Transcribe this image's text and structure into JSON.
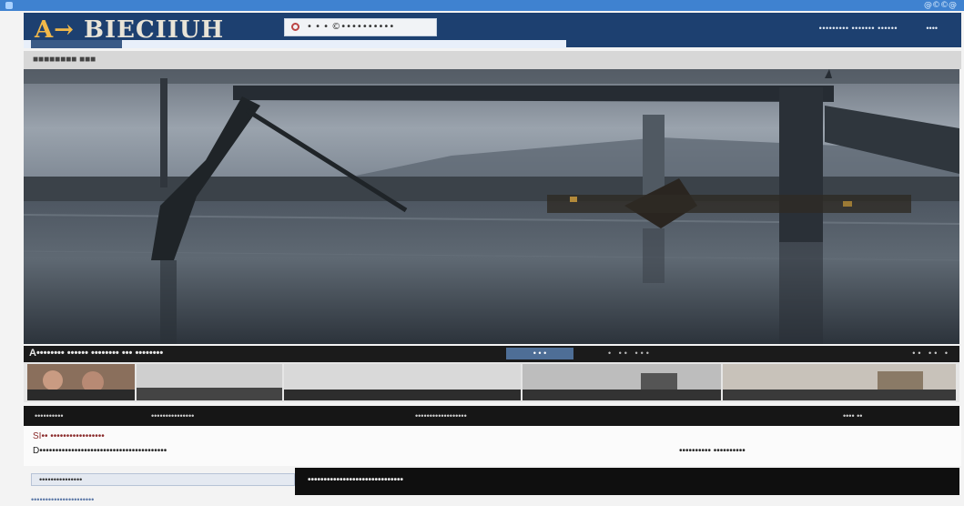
{
  "top": {
    "watermark": "@©©@"
  },
  "header": {
    "logo_prefix": "A→",
    "logo_text": "BIECIIUH",
    "search_text": "• • • ©••••••••••",
    "nav_text": "••••••••• ••••••• ••••••",
    "nav_right": "••••"
  },
  "grayband": {
    "text": "■■■■■■■■ ■■■"
  },
  "hero": {
    "image_label": "bridge-over-water-photo"
  },
  "titlebar": {
    "title": "A•••••••• •••••• •••••••• ••• ••••••••",
    "button": "• • •",
    "right_a": "• •• •••",
    "right_b": "•• •• •"
  },
  "darkbar": {
    "a": "••••••••••",
    "b": "•••••••••••••••",
    "c": "••••••••••••••••••",
    "d": "•••• ••"
  },
  "body_text": {
    "line1": "SI•• •••••••••••••••••",
    "line2": "D••••••••••••••••••••••••••••••••••••••••",
    "line3": "•••••••••• ••••••••••"
  },
  "bottom": {
    "link": "•••••••••••••••",
    "caption": "••••••••••••••••••••••••••••••",
    "footer": "••••••••••••••••••••••"
  },
  "colors": {
    "header_bg": "#1d4070",
    "top_strip": "#3f82d0",
    "button": "#4e6e96"
  }
}
